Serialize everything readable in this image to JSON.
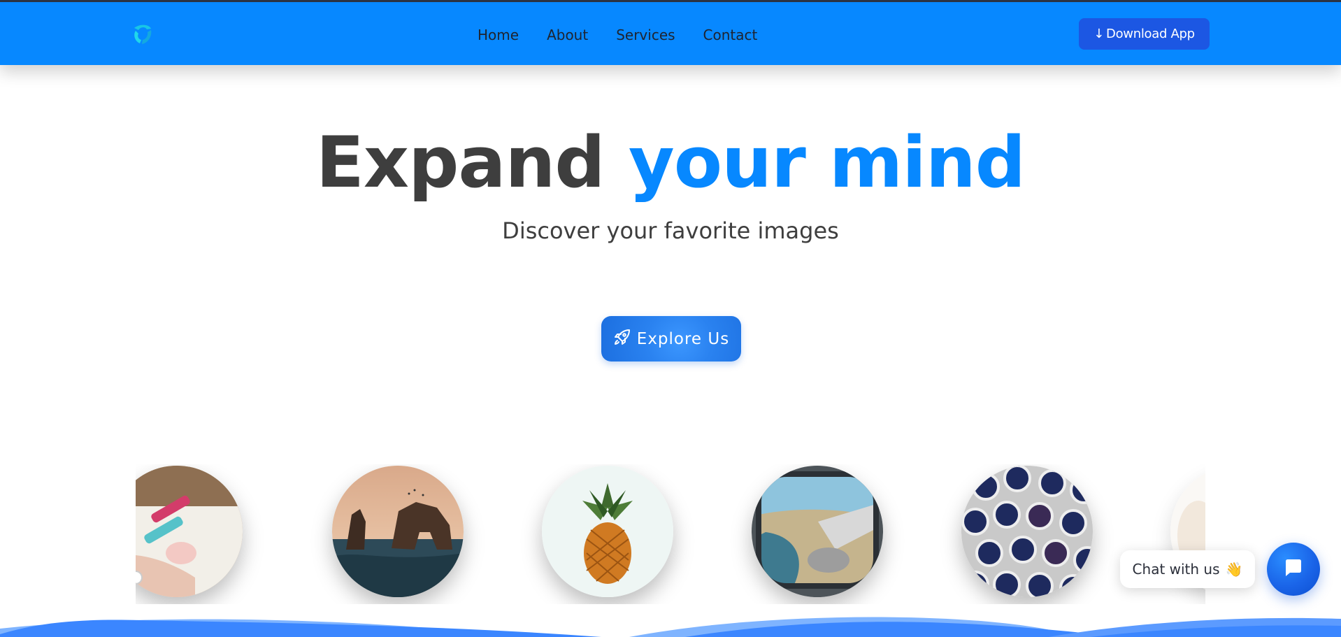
{
  "header": {
    "logo_icon": "swirl-logo-icon",
    "nav": {
      "home": "Home",
      "about": "About",
      "services": "Services",
      "contact": "Contact"
    },
    "download_label": "Download App",
    "download_icon": "arrow-down-icon"
  },
  "hero": {
    "title_part1": "Expand",
    "title_part2": "your mind",
    "subtitle": "Discover your favorite images",
    "explore_label": "Explore Us",
    "explore_icon": "rocket-icon"
  },
  "carousel": {
    "images": [
      "dumbbells-photo",
      "sea-arch-rocks-photo",
      "pineapple-photo",
      "airplane-window-photo",
      "wells-grid-photo",
      "partial-photo"
    ]
  },
  "chat": {
    "label": "Chat with us",
    "emoji": "👋",
    "fab_icon": "chat-bubble-icon"
  },
  "colors": {
    "brand": "#0788ff",
    "button_dark_blue": "#1c57e3",
    "heading": "#3e3e3e"
  }
}
